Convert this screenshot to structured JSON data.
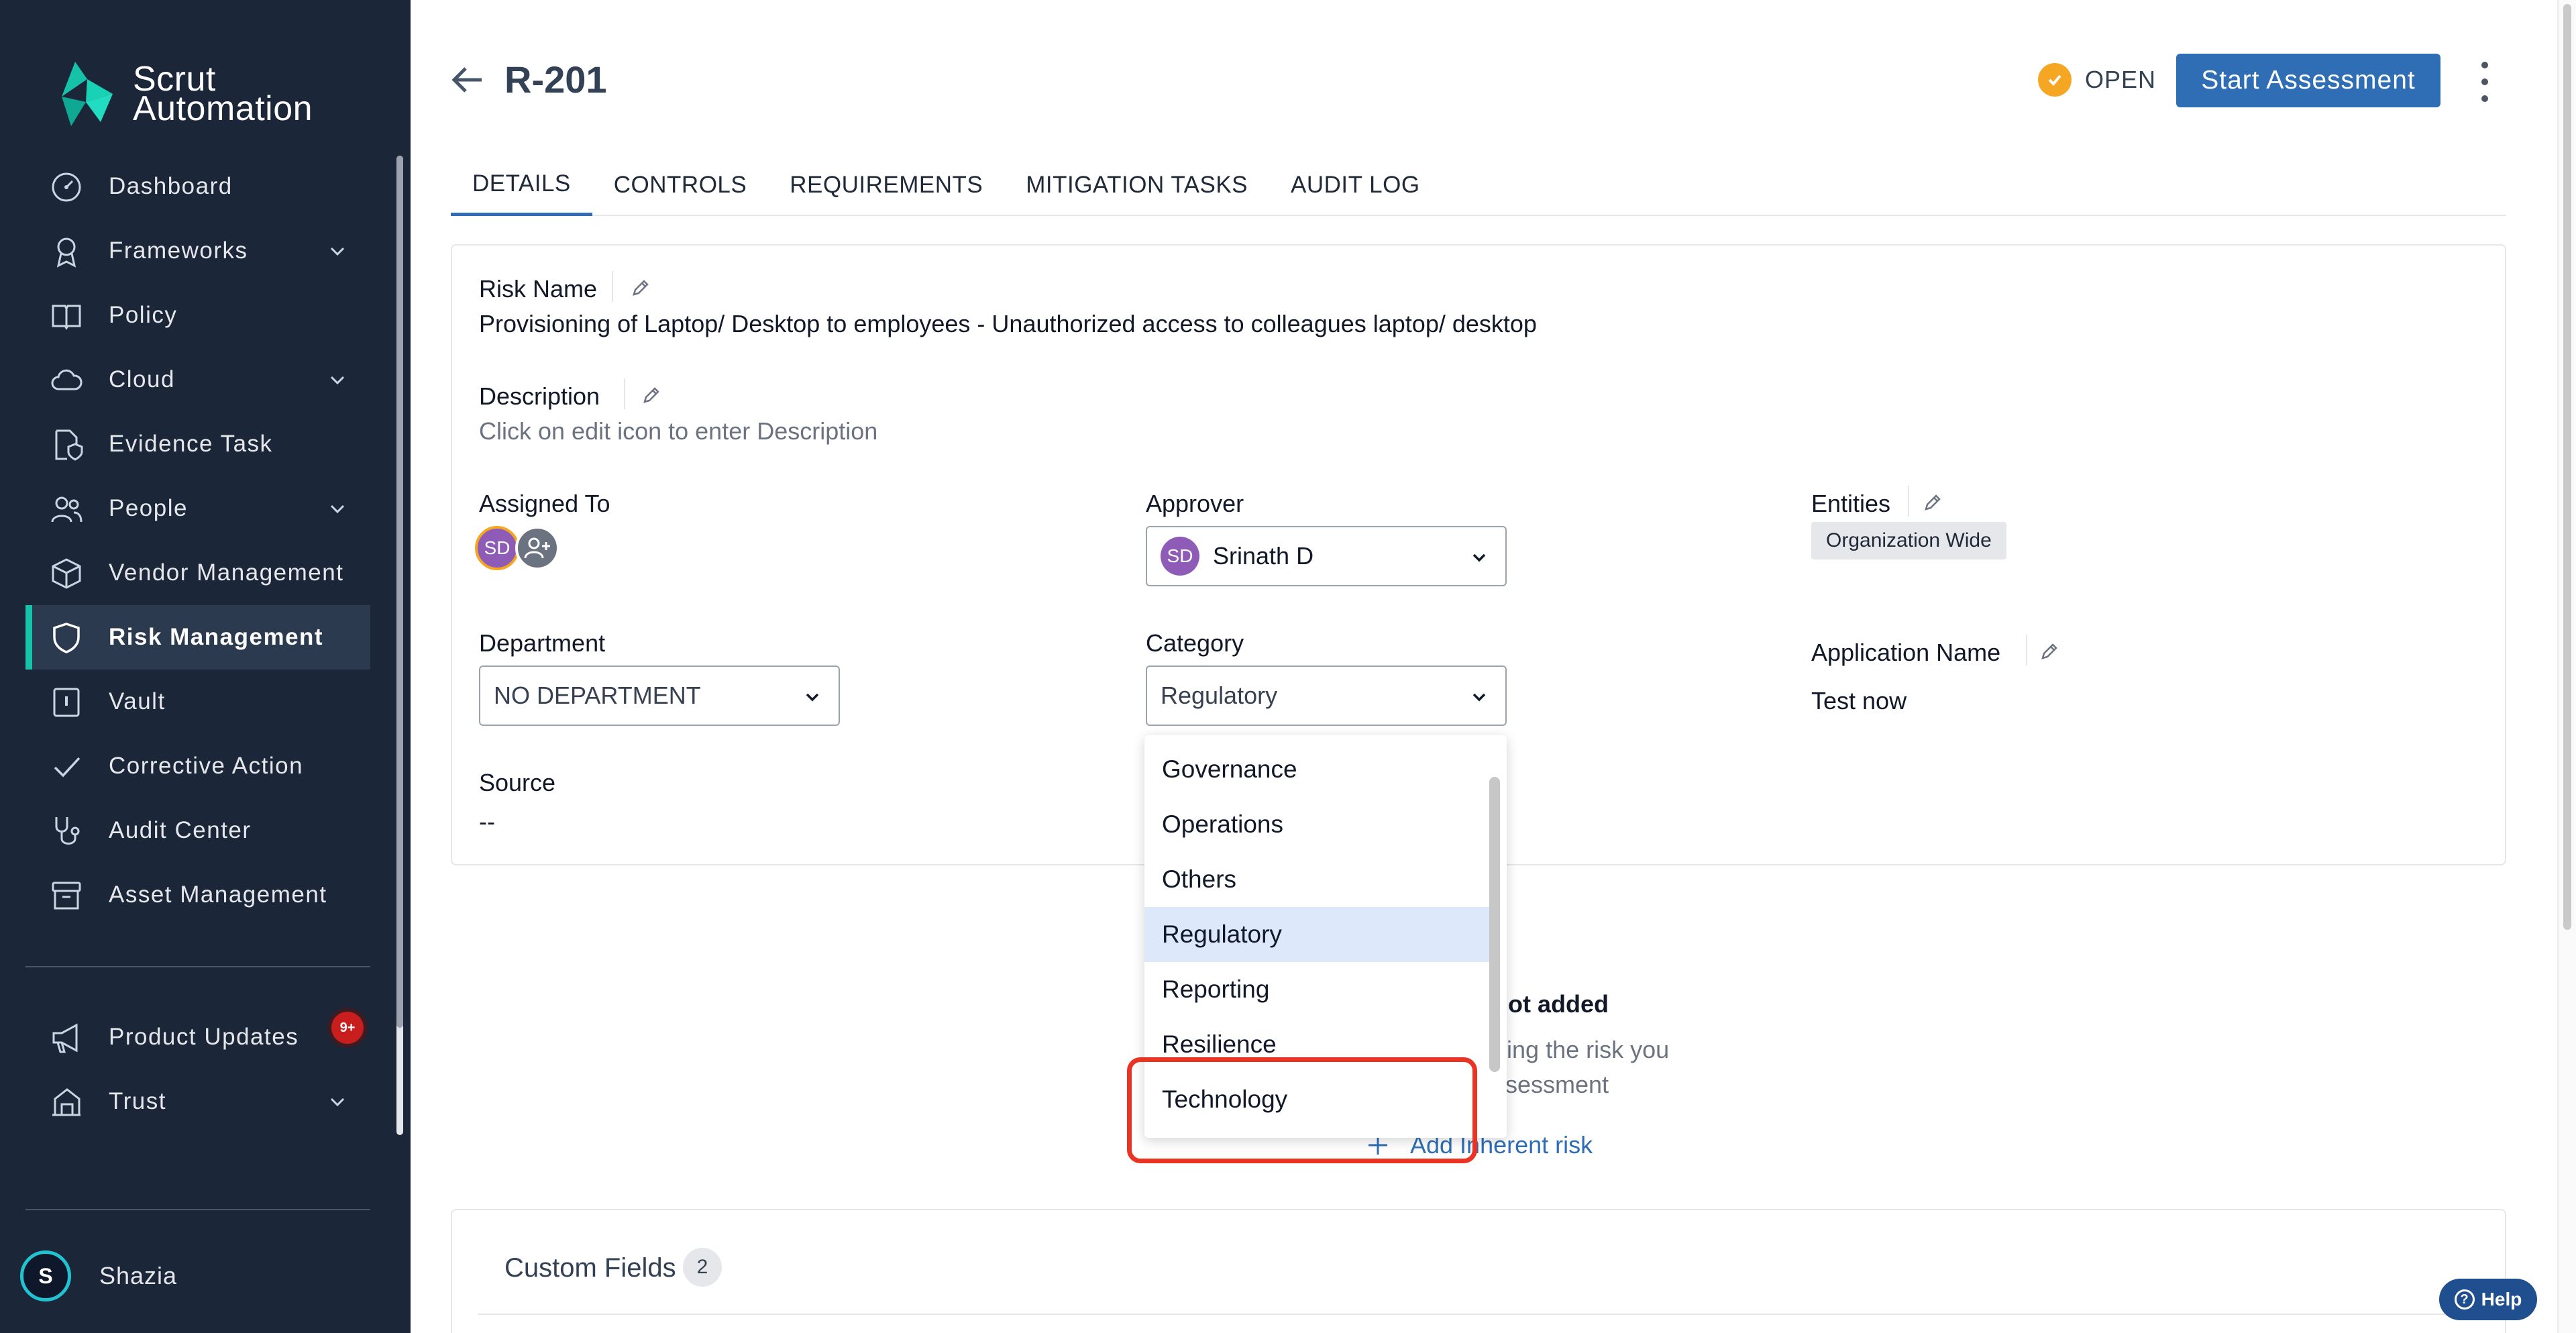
{
  "brand": {
    "name": "Scrut Automation",
    "line1": "Scrut",
    "line2": "Automation",
    "accent": "#17c3a8"
  },
  "sidebar": {
    "items": [
      {
        "label": "Dashboard",
        "icon": "dashboard-icon",
        "expandable": false
      },
      {
        "label": "Frameworks",
        "icon": "award-icon",
        "expandable": true
      },
      {
        "label": "Policy",
        "icon": "book-icon",
        "expandable": false
      },
      {
        "label": "Cloud",
        "icon": "cloud-icon",
        "expandable": true
      },
      {
        "label": "Evidence Task",
        "icon": "file-shield-icon",
        "expandable": false
      },
      {
        "label": "People",
        "icon": "people-icon",
        "expandable": true
      },
      {
        "label": "Vendor Management",
        "icon": "box-icon",
        "expandable": false
      },
      {
        "label": "Risk Management",
        "icon": "shield-icon",
        "expandable": false,
        "active": true
      },
      {
        "label": "Vault",
        "icon": "vault-icon",
        "expandable": false
      },
      {
        "label": "Corrective Action",
        "icon": "check-icon",
        "expandable": false
      },
      {
        "label": "Audit Center",
        "icon": "stethoscope-icon",
        "expandable": false
      },
      {
        "label": "Asset Management",
        "icon": "archive-icon",
        "expandable": false
      }
    ],
    "bottom_items": [
      {
        "label": "Product Updates",
        "icon": "megaphone-icon",
        "badge": "9+"
      },
      {
        "label": "Trust",
        "icon": "trust-icon",
        "expandable": true
      }
    ],
    "user": {
      "initial": "S",
      "name": "Shazia"
    }
  },
  "header": {
    "title": "R-201",
    "status": "OPEN",
    "status_color": "#f5a623",
    "primary_action": "Start Assessment",
    "primary_color": "#2f6db5"
  },
  "tabs": [
    "DETAILS",
    "CONTROLS",
    "REQUIREMENTS",
    "MITIGATION TASKS",
    "AUDIT LOG"
  ],
  "details": {
    "risk_name_label": "Risk Name",
    "risk_name": "Provisioning of Laptop/ Desktop to employees - Unauthorized access to colleagues laptop/ desktop",
    "description_label": "Description",
    "description_placeholder": "Click on edit icon to enter Description",
    "assigned_to_label": "Assigned To",
    "assignee_initials": "SD",
    "approver_label": "Approver",
    "approver_initials": "SD",
    "approver_name": "Srinath D",
    "entities_label": "Entities",
    "entities_tag": "Organization Wide",
    "department_label": "Department",
    "department_value": "NO DEPARTMENT",
    "category_label": "Category",
    "category_value": "Regulatory",
    "application_label": "Application Name",
    "application_value": "Test now",
    "source_label": "Source",
    "source_value": "--"
  },
  "category_dropdown": {
    "options": [
      "Governance",
      "Operations",
      "Others",
      "Regulatory",
      "Reporting",
      "Resilience",
      "Technology"
    ],
    "selected": "Regulatory"
  },
  "inherent_risk": {
    "title_fragment": "not added",
    "line1_fragment": "ging the risk you",
    "line2_fragment": "ssessment",
    "add_link": "Add Inherent risk"
  },
  "custom_fields": {
    "title": "Custom Fields",
    "count": "2"
  },
  "help": {
    "label": "Help"
  }
}
